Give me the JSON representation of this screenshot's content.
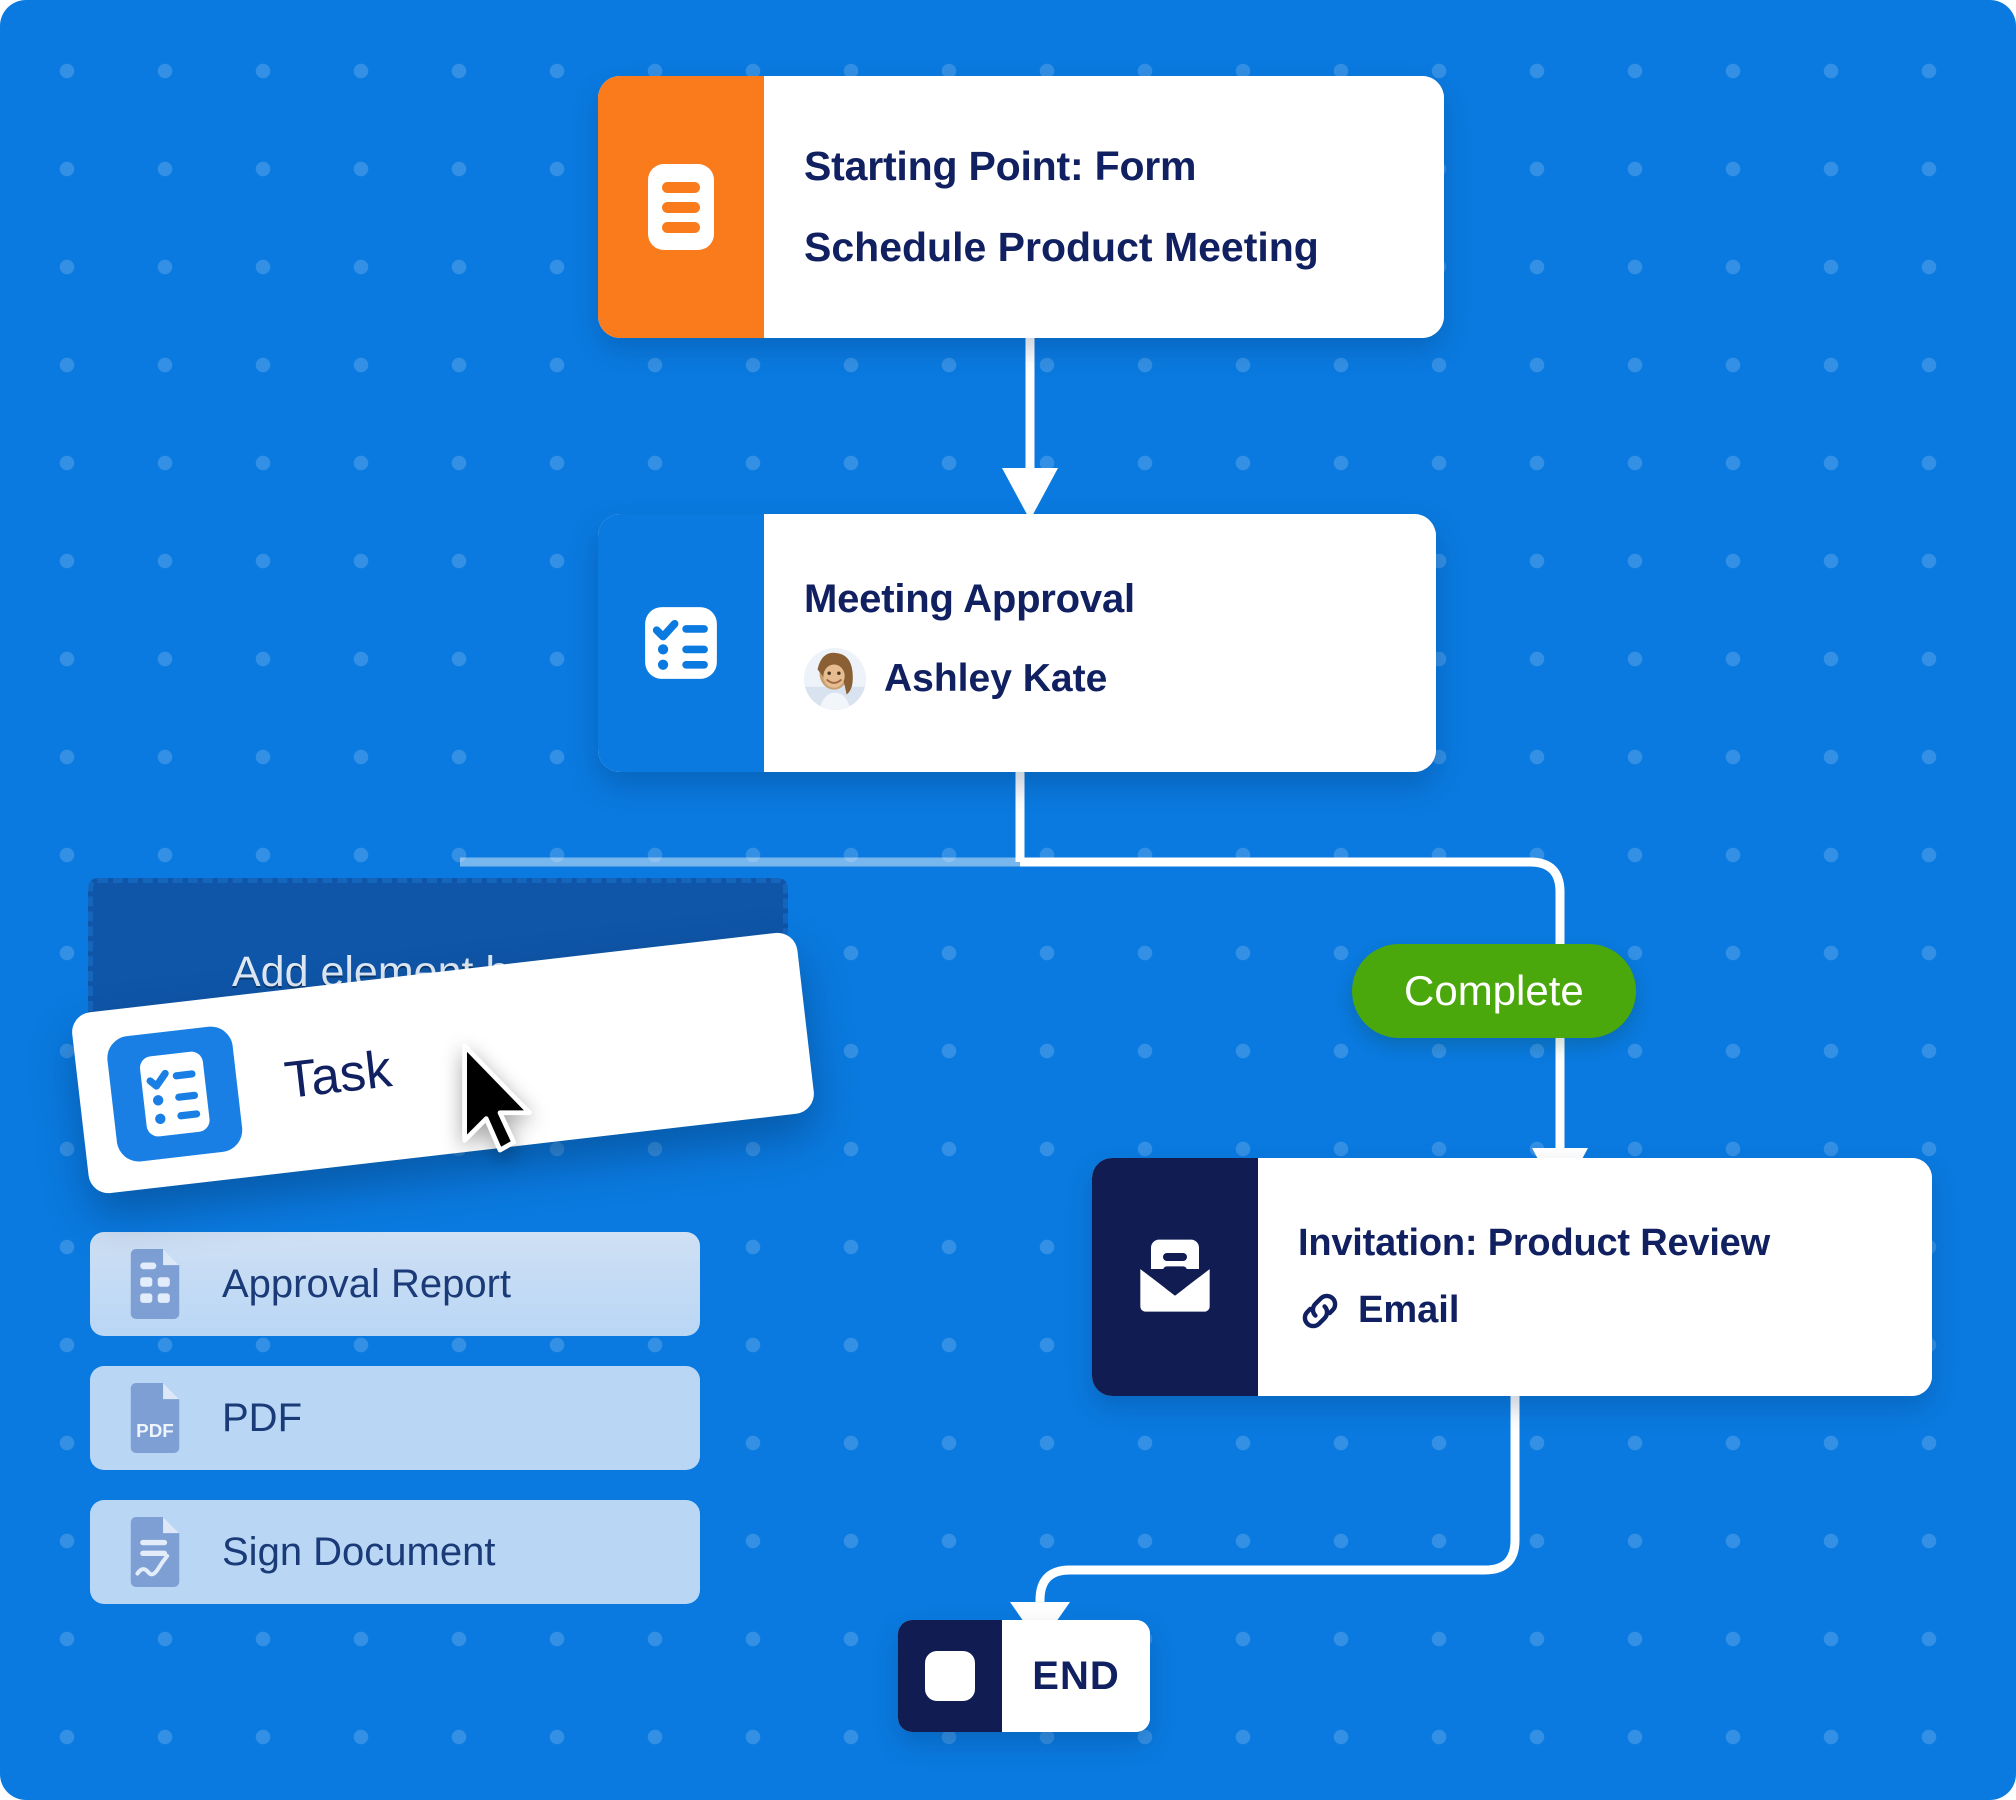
{
  "canvas": {
    "background_color": "#0a7ae0",
    "dot_color": "#3c97e8"
  },
  "nodes": {
    "start": {
      "icon": "form-icon",
      "accent_color": "#f97b1c",
      "title": "Starting Point: Form",
      "subtitle": "Schedule Product Meeting"
    },
    "approval": {
      "icon": "checklist-icon",
      "accent_color": "#0a7ae0",
      "title": "Meeting Approval",
      "assignee": "Ashley Kate",
      "avatar": "user-avatar"
    },
    "invitation": {
      "icon": "email-envelope-icon",
      "accent_color": "#101c52",
      "title": "Invitation: Product Review",
      "channel_icon": "link-icon",
      "channel": "Email"
    },
    "end": {
      "icon": "stop-square-icon",
      "accent_color": "#101c52",
      "label": "END"
    }
  },
  "badges": {
    "complete": {
      "label": "Complete",
      "color": "#4aa80c",
      "text_color": "#ffffff"
    }
  },
  "dropzone": {
    "label": "Add element here",
    "fill_color": "#0f56a8",
    "border_color": "#1565bd"
  },
  "drag": {
    "card_label": "Task",
    "card_icon": "checklist-icon",
    "icon_background": "#1a7fe4",
    "cursor": "mouse-pointer-icon"
  },
  "element_list": [
    {
      "label": "Approval Report",
      "icon": "report-document-icon"
    },
    {
      "label": "PDF",
      "icon": "pdf-file-icon"
    },
    {
      "label": "Sign Document",
      "icon": "signed-document-icon"
    }
  ]
}
